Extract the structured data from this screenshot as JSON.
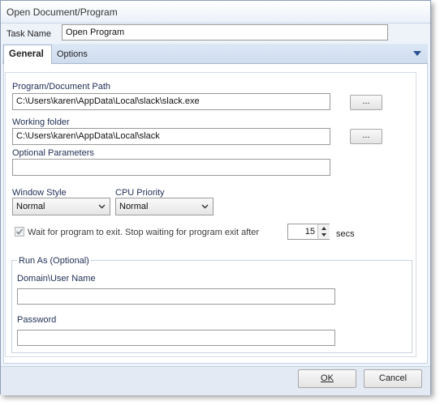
{
  "window": {
    "title": "Open Document/Program"
  },
  "task": {
    "label": "Task Name",
    "value": "Open Program"
  },
  "tabs": [
    {
      "label": "General",
      "active": true
    },
    {
      "label": "Options",
      "active": false
    }
  ],
  "program_path": {
    "label": "Program/Document Path",
    "value": "C:\\Users\\karen\\AppData\\Local\\slack\\slack.exe",
    "browse_label": "..."
  },
  "working_folder": {
    "label": "Working folder",
    "value": "C:\\Users\\karen\\AppData\\Local\\slack",
    "browse_label": "..."
  },
  "optional_params": {
    "label": "Optional Parameters",
    "value": ""
  },
  "window_style": {
    "label": "Window Style",
    "value": "Normal"
  },
  "cpu_priority": {
    "label": "CPU Priority",
    "value": "Normal"
  },
  "wait": {
    "label": "Wait for program to exit. Stop waiting for program exit after",
    "checked": true,
    "value": "15",
    "unit": "secs"
  },
  "run_as": {
    "group_label": "Run As (Optional)",
    "domain_label": "Domain\\User Name",
    "domain_value": "",
    "password_label": "Password",
    "password_value": ""
  },
  "footer": {
    "ok_label": "OK",
    "cancel_label": "Cancel"
  },
  "colors": {
    "accent": "#2a5aa8",
    "label_dark": "#1f2e55"
  }
}
